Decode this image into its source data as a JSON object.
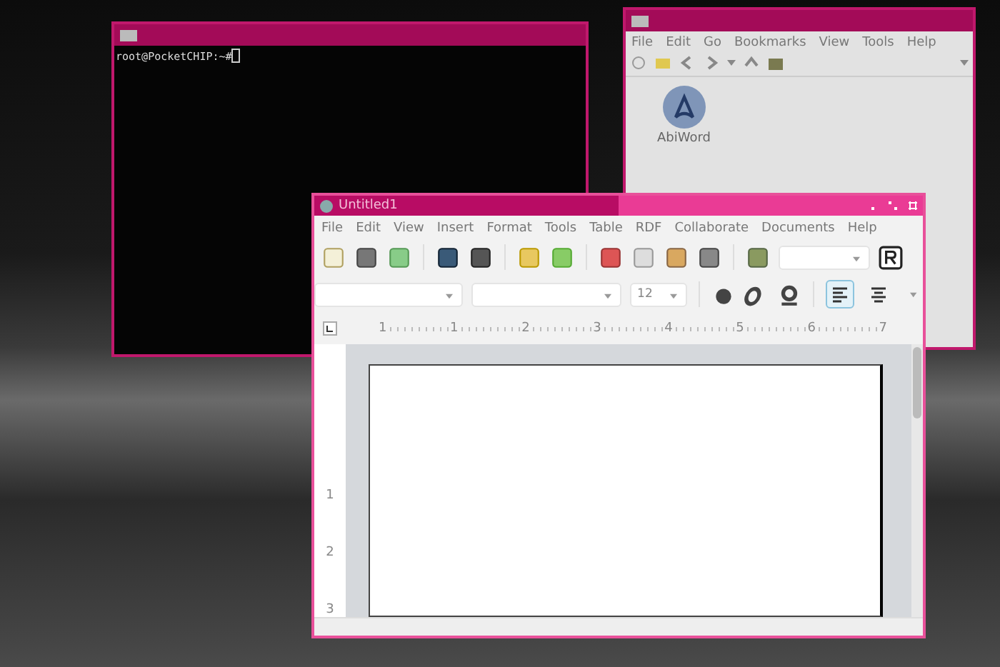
{
  "terminal": {
    "prompt": "root@PocketCHIP:~# "
  },
  "file_manager": {
    "menu": [
      "File",
      "Edit",
      "Go",
      "Bookmarks",
      "View",
      "Tools",
      "Help"
    ],
    "items": [
      {
        "label": "AbiWord"
      }
    ]
  },
  "abiword": {
    "title": "Untitled1",
    "menu": [
      "File",
      "Edit",
      "View",
      "Insert",
      "Format",
      "Tools",
      "Table",
      "RDF",
      "Collaborate",
      "Documents",
      "Help"
    ],
    "font_size": "12",
    "align_buttons": [
      {
        "kind": "left",
        "selected": true
      },
      {
        "kind": "center",
        "selected": false
      }
    ],
    "ruler_labels": [
      "1",
      "1",
      "2",
      "3",
      "4",
      "5",
      "6",
      "7"
    ],
    "vertical_ruler_labels": [
      "1",
      "2",
      "3"
    ]
  }
}
